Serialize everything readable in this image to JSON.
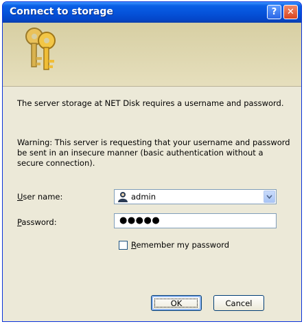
{
  "dialog": {
    "title": "Connect to storage",
    "help_symbol": "?",
    "close_symbol": "✕"
  },
  "message": {
    "line1": "The server storage at NET Disk requires a username and password.",
    "line2": "Warning: This server is requesting that your username and password be sent in an insecure manner (basic authentication without a secure connection)."
  },
  "form": {
    "user_label_ul": "U",
    "user_label_rest": "ser name:",
    "user_value": "admin",
    "pass_label_ul": "P",
    "pass_label_rest": "assword:",
    "pass_value": "●●●●●",
    "remember_ul": "R",
    "remember_rest": "emember my password"
  },
  "buttons": {
    "ok": "OK",
    "cancel": "Cancel"
  },
  "colors": {
    "titlebar": "#0552d9",
    "dialog_bg": "#ece9d8",
    "banner_bg": "#dcd5b1"
  },
  "icons": [
    "keys-icon",
    "user-icon",
    "chevron-down-icon",
    "help-icon",
    "close-icon"
  ]
}
